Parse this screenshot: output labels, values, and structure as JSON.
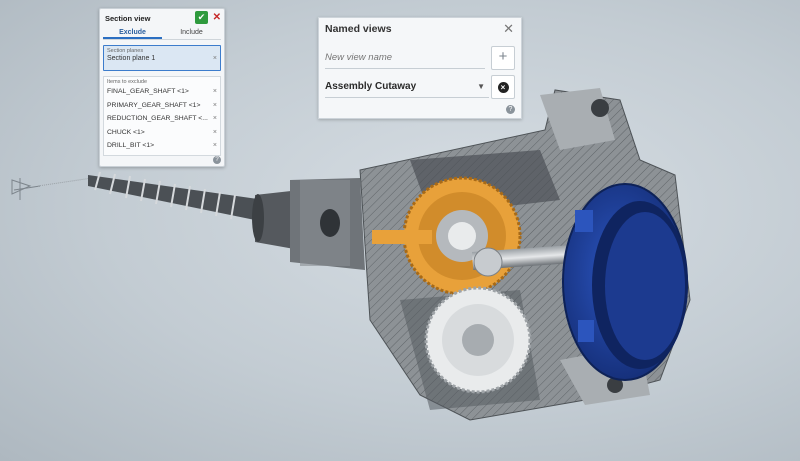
{
  "section_view": {
    "title": "Section view",
    "tabs": [
      "Exclude",
      "Include"
    ],
    "active_tab": "Exclude",
    "planes_label": "Section planes",
    "planes": [
      {
        "label": "Section plane 1"
      }
    ],
    "items_label": "Items to exclude",
    "items": [
      {
        "label": "FINAL_GEAR_SHAFT <1>"
      },
      {
        "label": "PRIMARY_GEAR_SHAFT <1>"
      },
      {
        "label": "REDUCTION_GEAR_SHAFT <..."
      },
      {
        "label": "CHUCK <1>"
      },
      {
        "label": "DRILL_BIT <1>"
      }
    ],
    "confirm_icon": "check-icon",
    "cancel_icon": "close-icon",
    "remove_icon": "close-icon",
    "help_icon": "help-icon"
  },
  "named_views": {
    "title": "Named views",
    "close_icon": "close-icon",
    "input_placeholder": "New view name",
    "input_value": "",
    "add_icon": "plus-icon",
    "selected_view": "Assembly Cutaway",
    "dropdown_icon": "caret-down-icon",
    "clear_icon": "clear-circle-icon",
    "help_icon": "help-icon"
  },
  "model": {
    "description_icon": "section-plane-glyph",
    "colors": {
      "gear_orange": "#e8a13a",
      "housing_gray": "#8a8f94",
      "cap_blue": "#1d3f9b",
      "gear_white": "#e9ebec"
    }
  }
}
